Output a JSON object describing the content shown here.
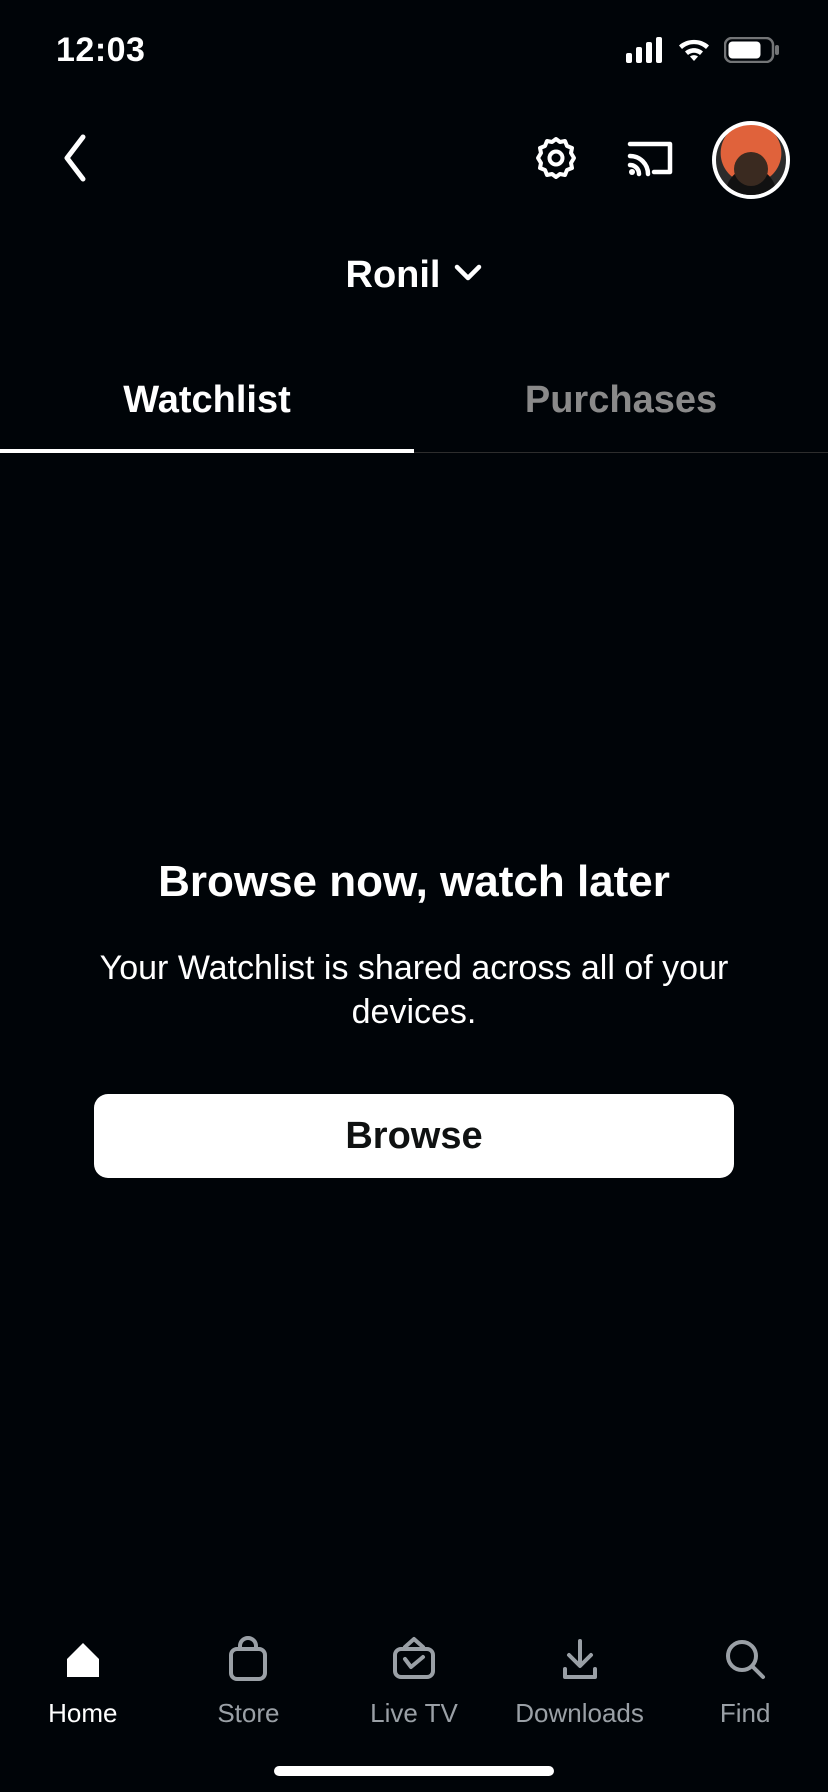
{
  "status": {
    "time": "12:03"
  },
  "profile": {
    "name": "Ronil"
  },
  "tabs": {
    "watchlist": "Watchlist",
    "purchases": "Purchases"
  },
  "empty": {
    "title": "Browse now, watch later",
    "subtitle": "Your Watchlist is shared across all of your devices.",
    "cta": "Browse"
  },
  "nav": {
    "home": "Home",
    "store": "Store",
    "livetv": "Live TV",
    "downloads": "Downloads",
    "find": "Find"
  }
}
